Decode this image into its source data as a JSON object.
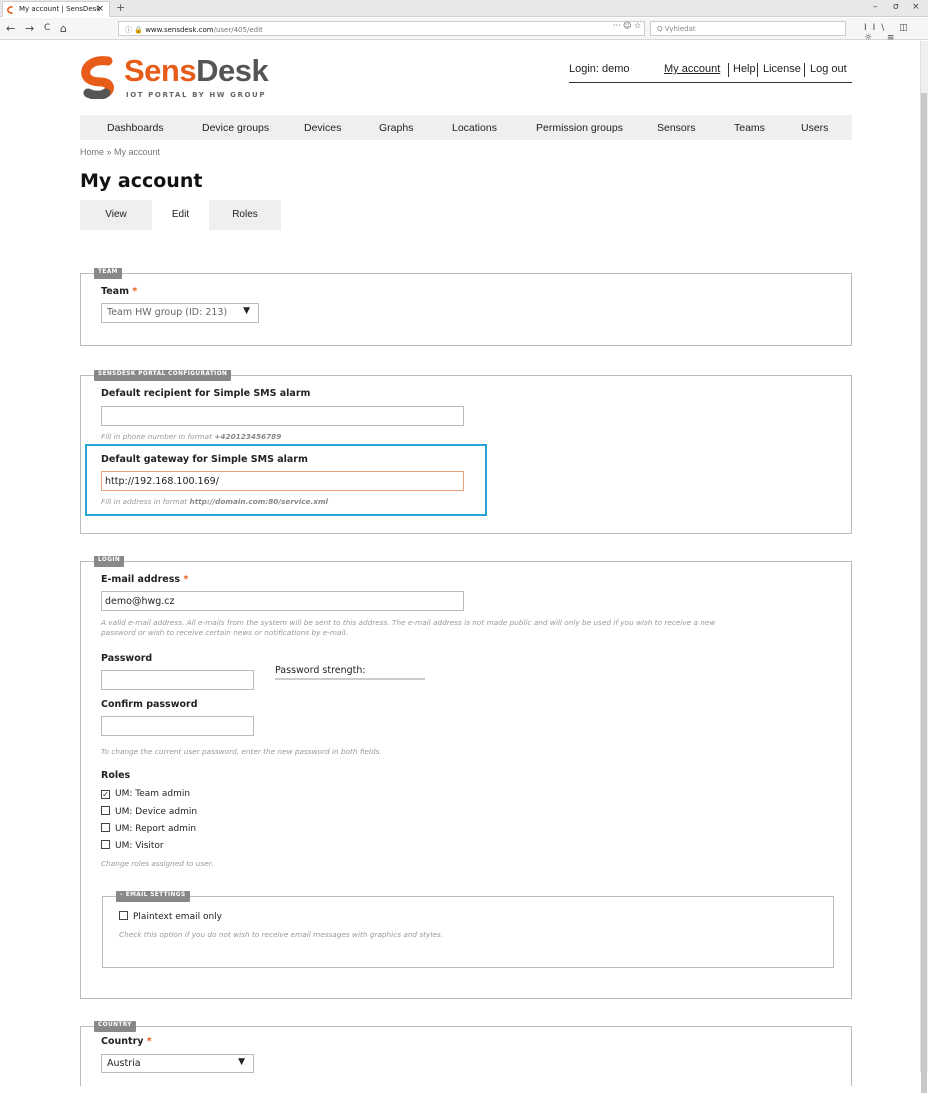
{
  "browser": {
    "tab_title": "My account | SensDesk",
    "tab_close": "×",
    "new_tab": "+",
    "window_controls": [
      "–",
      "σ",
      "×"
    ],
    "back": "←",
    "forward": "→",
    "reload": "C",
    "home": "⌂",
    "url_prefix": "ⓘ 🔒",
    "url_host": "www.sensdesk.com",
    "url_path": "/user/405/edit",
    "url_icons": "··· ☺ ☆",
    "search_placeholder": "Q Vyhledat",
    "toolbar_icons": "II\\ ◫ ☼ ≡"
  },
  "brand": {
    "name_part1": "Sens",
    "name_part2": "Desk",
    "tagline": "IOT PORTAL BY HW GROUP",
    "colors": {
      "accent": "#e85c1a",
      "logo_gray": "#555555"
    }
  },
  "userbar": {
    "login": "Login: demo",
    "my_account": "My account",
    "help": "Help",
    "license": "License",
    "logout": "Log out"
  },
  "menu": [
    "Dashboards",
    "Device groups",
    "Devices",
    "Graphs",
    "Locations",
    "Permission groups",
    "Sensors",
    "Teams",
    "Users"
  ],
  "breadcrumb": "Home » My account",
  "page_title": "My account",
  "tabs": [
    "View",
    "Edit",
    "Roles"
  ],
  "team": {
    "legend": "TEAM",
    "label": "Team",
    "required": "*",
    "selected": "Team HW group (ID: 213)",
    "arrow": "▼"
  },
  "config": {
    "legend": "SENSDESK PORTAL CONFIGURATION",
    "recipient_label": "Default recipient for Simple SMS alarm",
    "recipient_value": "",
    "recipient_desc_prefix": "Fill in phone number in format",
    "recipient_desc_example": "+420123456789",
    "gateway_label": "Default gateway for Simple SMS alarm",
    "gateway_value": "http://192.168.100.169/",
    "gateway_desc_prefix": "Fill in address in format",
    "gateway_desc_example": "http://domain.com:80/service.xml",
    "highlight_color": "#29a3d6"
  },
  "login": {
    "legend": "LOGIN",
    "email_label": "E-mail address",
    "required": "*",
    "email_value": "demo@hwg.cz",
    "email_desc_line1": "A valid e-mail address. All e-mails from the system will be sent to this address. The e-mail address is not made public and will only be used if you wish to receive a new",
    "email_desc_line2": "password or wish to receive certain news or notifications by e-mail.",
    "password_label": "Password",
    "password_strength": "Password strength:",
    "confirm_label": "Confirm password",
    "password_desc": "To change the current user password, enter the new password in both fields.",
    "roles_label": "Roles",
    "roles": [
      {
        "label": "UM: Team admin",
        "checked": true,
        "mark": "✓"
      },
      {
        "label": "UM: Device admin",
        "checked": false,
        "mark": ""
      },
      {
        "label": "UM: Report admin",
        "checked": false,
        "mark": ""
      },
      {
        "label": "UM: Visitor",
        "checked": false,
        "mark": ""
      }
    ],
    "roles_desc": "Change roles assigned to user."
  },
  "email_settings": {
    "legend": "– EMAIL SETTINGS",
    "plaintext_label": "Plaintext email only",
    "plaintext_checked": false,
    "plaintext_desc": "Check this option if you do not wish to receive email messages with graphics and styles."
  },
  "country": {
    "legend": "COUNTRY",
    "label": "Country",
    "required": "*",
    "selected": "Austria",
    "arrow": "▼"
  }
}
